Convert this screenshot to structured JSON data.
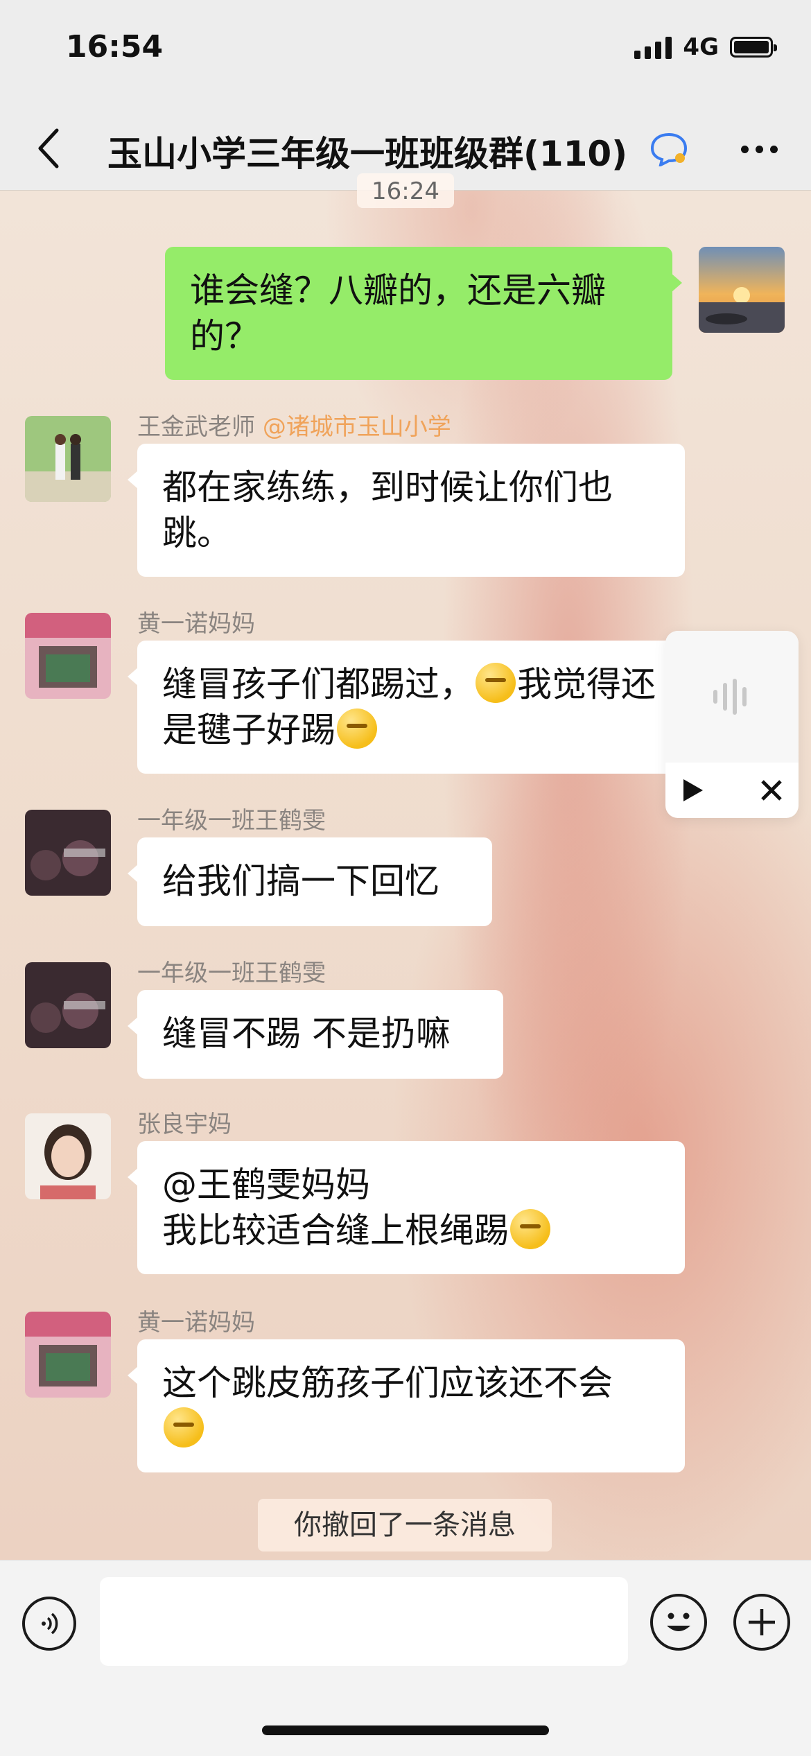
{
  "status_bar": {
    "time": "16:54",
    "network": "4G"
  },
  "header": {
    "title": "玉山小学三年级一班班级群(110)"
  },
  "timestamp_partial": "16:24",
  "messages": [
    {
      "sender": "",
      "text": "谁会缝？八瓣的，还是六瓣的？",
      "mine": true
    },
    {
      "sender": "王金武老师",
      "sender_tag": "@诸城市玉山小学",
      "text": "都在家练练，到时候让你们也跳。"
    },
    {
      "sender": "黄一诺妈妈",
      "text_part1": "缝冒孩子们都踢过，",
      "text_part2": "我觉得还是毽子好踢"
    },
    {
      "sender": "一年级一班王鹤雯",
      "text": "给我们搞一下回忆"
    },
    {
      "sender": "一年级一班王鹤雯",
      "text": "缝冒不踢 不是扔嘛"
    },
    {
      "sender": "张良宇妈",
      "text_line1": "@王鹤雯妈妈",
      "text_line2": "我比较适合缝上根绳踢"
    },
    {
      "sender": "黄一诺妈妈",
      "text": "这个跳皮筋孩子们应该还不会"
    }
  ],
  "system_message": "你撤回了一条消息",
  "input": {
    "value": "",
    "placeholder": ""
  },
  "icons": {
    "back": "chevron-left-icon",
    "more": "more-dots-icon",
    "voice": "voice-icon",
    "emoji": "emoji-face-icon",
    "plus": "plus-icon",
    "play": "play-icon",
    "close": "close-icon"
  },
  "colors": {
    "mine_bubble": "#95ec69",
    "tag": "#f0a35a"
  }
}
